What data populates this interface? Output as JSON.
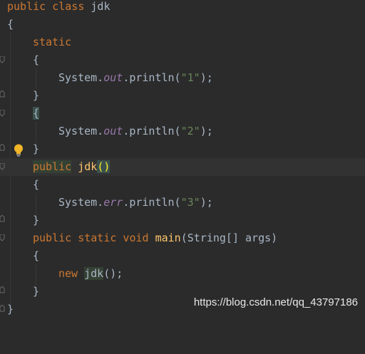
{
  "code": {
    "l1": {
      "kw": "public class",
      "name": " jdk"
    },
    "l2": {
      "brace": "{"
    },
    "l3": {
      "kw": "static"
    },
    "l4": {
      "brace": "{"
    },
    "l5": {
      "pre": "System.",
      "field": "out",
      "call": ".println(",
      "str": "\"1\"",
      "end": ");"
    },
    "l6": {
      "brace": "}"
    },
    "l7": {
      "brace": "{"
    },
    "l8": {
      "pre": "System.",
      "field": "out",
      "call": ".println(",
      "str": "\"2\"",
      "end": ");"
    },
    "l9": {
      "brace": "}"
    },
    "l10": {
      "kw": "public",
      "name": "jdk",
      "paren": "()"
    },
    "l11": {
      "brace": "{"
    },
    "l12": {
      "pre": "System.",
      "field": "err",
      "call": ".println(",
      "str": "\"3\"",
      "end": ");"
    },
    "l13": {
      "brace": "}"
    },
    "l14": {
      "kw": "public static void",
      "method": "main",
      "rest": "(String[] args)"
    },
    "l15": {
      "brace": "{"
    },
    "l16": {
      "kw": "new",
      "cls": "jdk",
      "end": "();"
    },
    "l17": {
      "brace": "}"
    },
    "l18": {
      "brace": "}"
    }
  },
  "watermark": "https://blog.csdn.net/qq_43797186",
  "colors": {
    "background": "#2b2b2b",
    "keyword": "#cc7832",
    "field": "#9876aa",
    "string": "#6a8759",
    "method": "#ffc66d",
    "text": "#a9b7c6"
  },
  "icons": [
    "intention-bulb-icon",
    "fold-marker-icon"
  ]
}
